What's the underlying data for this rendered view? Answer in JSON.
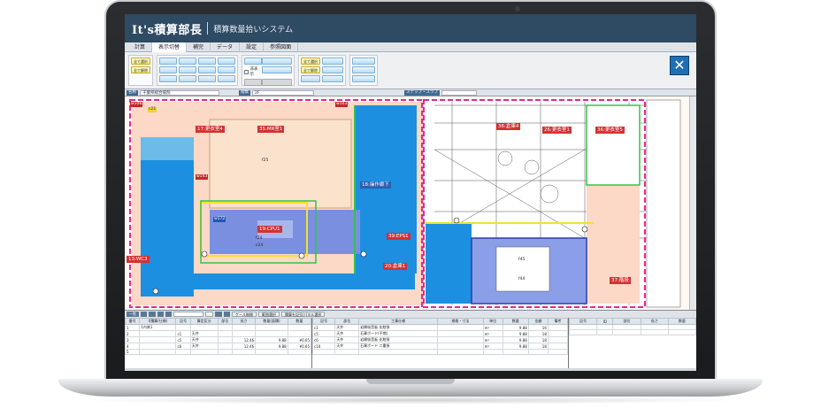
{
  "app": {
    "title": "It's積算部長",
    "subtitle": "積算数量拾いシステム"
  },
  "menu": [
    "計算",
    "表示切替",
    "補完",
    "データ",
    "設定",
    "参照図面"
  ],
  "ribbon": {
    "group1": [
      "全て選択",
      "全て解除"
    ],
    "group2_rows": 2,
    "group3_check": "非表示",
    "close_icon": "✕"
  },
  "info": {
    "label1": "名称",
    "value1": "千葉県総合病院",
    "label2": "階数",
    "value2": "2F",
    "label3": "ステップ・スラブ"
  },
  "rooms": [
    {
      "name": "17:更衣室4"
    },
    {
      "name": "35:MR室1"
    },
    {
      "name": "18:操作廊下"
    },
    {
      "name": "19:CPU1"
    },
    {
      "name": "39:EPS1"
    },
    {
      "name": "13:WC3"
    },
    {
      "name": "20:倉庫1"
    },
    {
      "name": "36:倉庫4"
    },
    {
      "name": "26:更衣室1"
    },
    {
      "name": "36:更衣室5"
    },
    {
      "name": "37:階段"
    }
  ],
  "marks": [
    "f25",
    "f24",
    "c24",
    "f45",
    "f44",
    "w143",
    "w108",
    "c21",
    "w172",
    "w103"
  ],
  "bottom_tools": [
    "一覧",
    "ケール無線",
    "範囲選択",
    "積算を記号/パネル選択"
  ],
  "tables": {
    "left": {
      "headers": [
        "番号",
        "Ⅰ(積算/仕様)",
        "記号",
        "算定区分",
        "部位",
        "長さ",
        "数量(面積)",
        "数量"
      ],
      "rows": [
        [
          "1",
          "1内装1",
          "",
          "",
          "",
          "",
          "",
          ""
        ],
        [
          "2",
          "",
          "c1",
          "天井",
          "",
          "",
          "",
          ""
        ],
        [
          "3",
          "",
          "c5",
          "天井",
          "",
          "12.46",
          "9.88",
          "¥0.65"
        ],
        [
          "4",
          "",
          "c6",
          "天井",
          "",
          "12.46",
          "9.88",
          "¥0.65"
        ],
        [
          "5",
          "",
          "",
          "",
          "",
          "",
          "",
          ""
        ]
      ]
    },
    "middle": {
      "headers": [
        "記号",
        "部位",
        "工事仕様",
        "規格・寸法",
        "単位",
        "数量",
        "金額",
        "備考"
      ],
      "rows": [
        [
          "c1",
          "天井",
          "岩綿吸音板 化粧張",
          "",
          "m²",
          "9.88",
          "16",
          ""
        ],
        [
          "c5",
          "天井",
          "石膏ボード(不燃)",
          "",
          "m²",
          "9.88",
          "18",
          ""
        ],
        [
          "c6",
          "天井",
          "岩綿吸音板 化粧張",
          "",
          "m²",
          "9.88",
          "18",
          ""
        ],
        [
          "c10",
          "天井",
          "石膏ボード 二重張",
          "",
          "m²",
          "9.88",
          "18",
          ""
        ],
        [
          "",
          "",
          "",
          "",
          "",
          "",
          "",
          ""
        ]
      ]
    },
    "right": {
      "headers": [
        "記号",
        "ID",
        "部位",
        "長さ",
        "数量"
      ],
      "rows": [
        [
          "",
          "",
          "",
          "",
          ""
        ],
        [
          "",
          "",
          "",
          "",
          ""
        ]
      ]
    }
  }
}
